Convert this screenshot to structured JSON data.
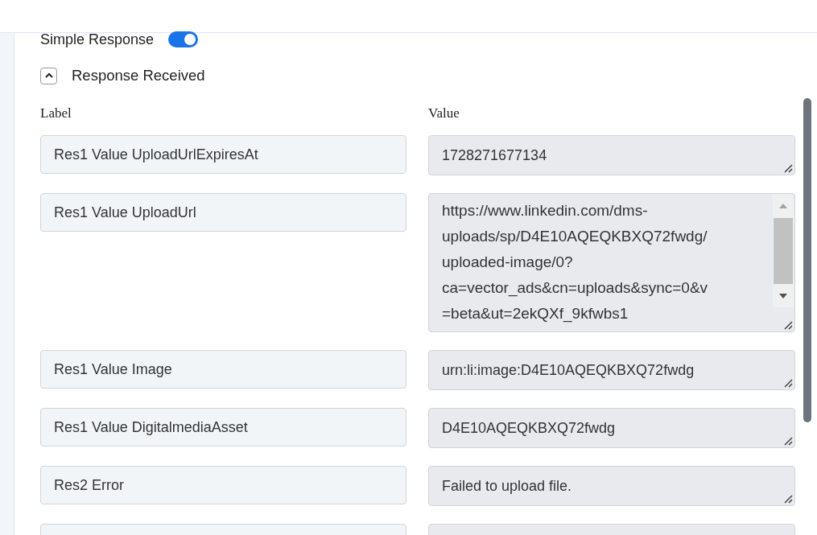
{
  "simple_response": {
    "label": "Simple Response",
    "on": true
  },
  "section": {
    "title": "Response Received",
    "expanded": true
  },
  "columns": [
    "Label",
    "Value"
  ],
  "rows": [
    {
      "kind": "single",
      "label": "Res1 Value UploadUrlExpiresAt",
      "value": [
        "1728271677134"
      ]
    },
    {
      "kind": "multiline",
      "label": "Res1 Value UploadUrl",
      "value": [
        "https://www.linkedin.com/dms-",
        "uploads/sp/D4E10AQEQKBXQ72fwdg/",
        "uploaded-image/0?",
        "ca=vector_ads&cn=uploads&sync=0&v",
        "=beta&ut=2ekQXf_9kfwbs1"
      ]
    },
    {
      "kind": "single",
      "label": "Res1 Value Image",
      "value": [
        "urn:li:image:D4E10AQEQKBXQ72fwdg"
      ]
    },
    {
      "kind": "single",
      "label": "Res1 Value DigitalmediaAsset",
      "value": [
        "D4E10AQEQKBXQ72fwdg"
      ]
    },
    {
      "kind": "single",
      "label": "Res2 Error",
      "value": [
        "Failed to upload file."
      ]
    }
  ]
}
